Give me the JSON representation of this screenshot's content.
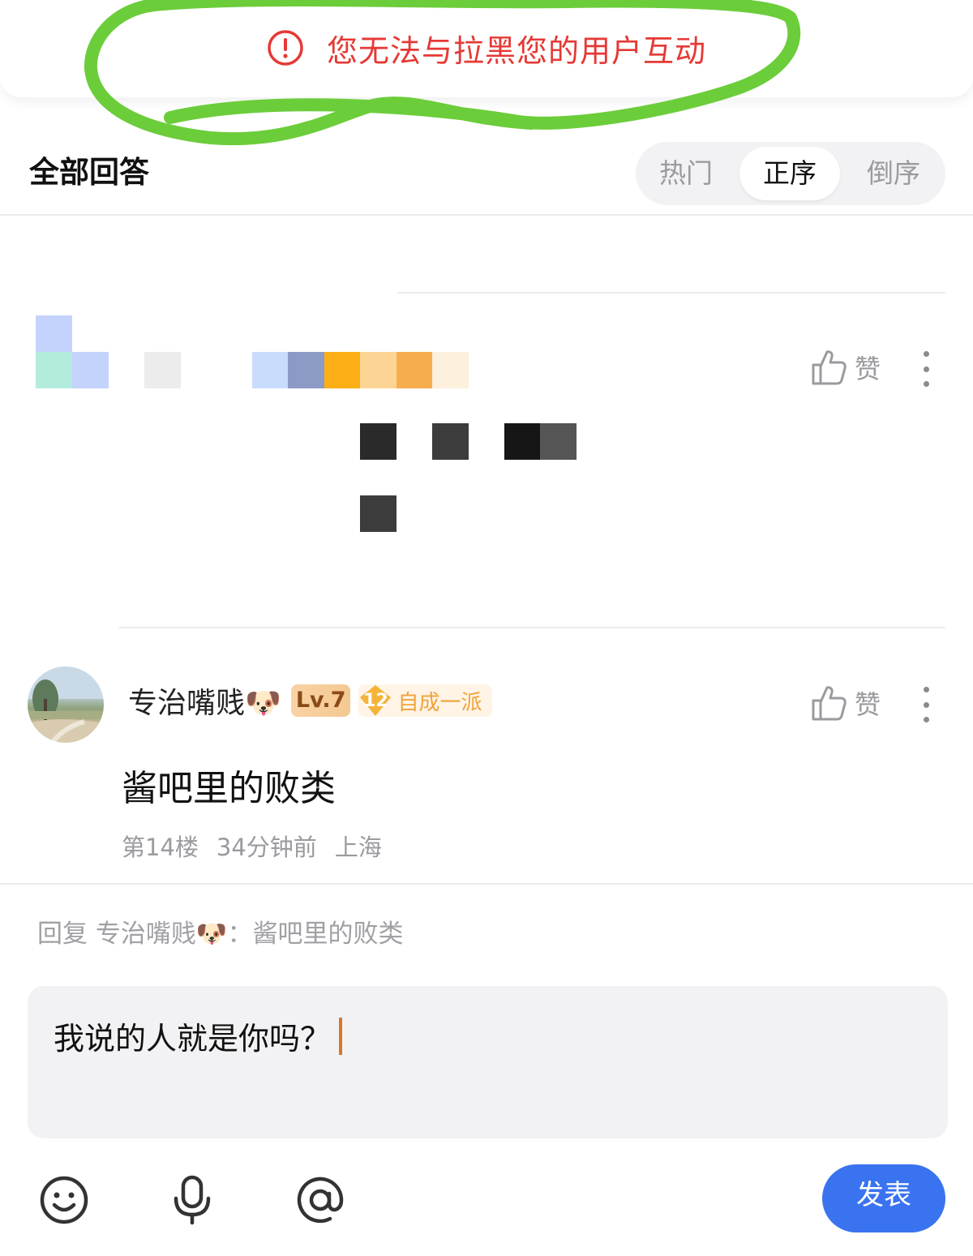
{
  "toast": {
    "message": "您无法与拉黑您的用户互动"
  },
  "answers": {
    "title": "全部回答",
    "sort_tabs": [
      {
        "label": "热门"
      },
      {
        "label": "正序"
      },
      {
        "label": "倒序"
      }
    ],
    "active_sort": "正序"
  },
  "like_label": "赞",
  "comment": {
    "username": "专治嘴贱🐶",
    "level": "Lv.7",
    "fan_level": "12",
    "fan_title": "自成一派",
    "text": "酱吧里的败类",
    "floor": "第14楼",
    "time": "34分钟前",
    "location": "上海"
  },
  "reply": {
    "hint": "回复 专治嘴贱🐶：酱吧里的败类",
    "input_value": "我说的人就是你吗？",
    "send_label": "发表"
  },
  "colors": {
    "alert": "#e53935",
    "accent_blue": "#3a73f0",
    "highlight_green": "#6ccd3b",
    "caret": "#d8772a"
  }
}
